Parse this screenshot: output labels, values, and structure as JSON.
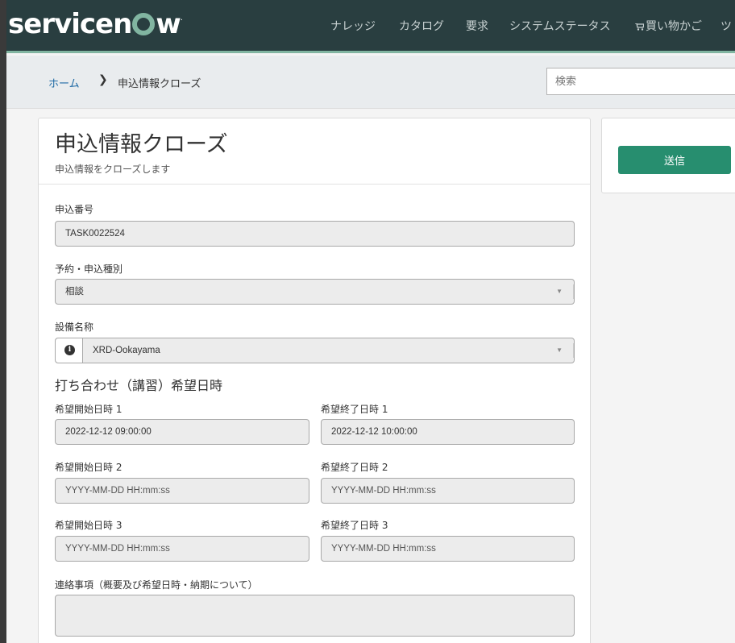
{
  "header": {
    "logo_text_1": "servicen",
    "logo_text_2": "w",
    "logo_tm": ".",
    "nav": [
      "ナレッジ",
      "カタログ",
      "要求",
      "システムステータス",
      "買い物かご",
      "ツ"
    ]
  },
  "breadcrumb": {
    "home": "ホーム",
    "separator": "❯",
    "current": "申込情報クローズ"
  },
  "search": {
    "placeholder": "検索"
  },
  "form": {
    "title": "申込情報クローズ",
    "subtitle": "申込情報をクローズします",
    "application_number": {
      "label": "申込番号",
      "value": "TASK0022524"
    },
    "reservation_type": {
      "label": "予約・申込種別",
      "value": "相談"
    },
    "facility_name": {
      "label": "設備名称",
      "value": "XRD-Ookayama"
    },
    "section_heading": "打ち合わせ（講習）希望日時",
    "datetimes": [
      {
        "start_label": "希望開始日時 1",
        "start_value": "2022-12-12 09:00:00",
        "end_label": "希望終了日時 1",
        "end_value": "2022-12-12 10:00:00"
      },
      {
        "start_label": "希望開始日時 2",
        "start_value": "YYYY-MM-DD HH:mm:ss",
        "end_label": "希望終了日時 2",
        "end_value": "YYYY-MM-DD HH:mm:ss"
      },
      {
        "start_label": "希望開始日時 3",
        "start_value": "YYYY-MM-DD HH:mm:ss",
        "end_label": "希望終了日時 3",
        "end_value": "YYYY-MM-DD HH:mm:ss"
      }
    ],
    "notes": {
      "label": "連絡事項（概要及び希望日時・納期について）",
      "value": ""
    }
  },
  "sidebar": {
    "submit_label": "送信"
  },
  "colors": {
    "header_bg": "#293e40",
    "accent": "#81b5a1",
    "submit": "#278e6f",
    "link": "#1f6aa5"
  }
}
